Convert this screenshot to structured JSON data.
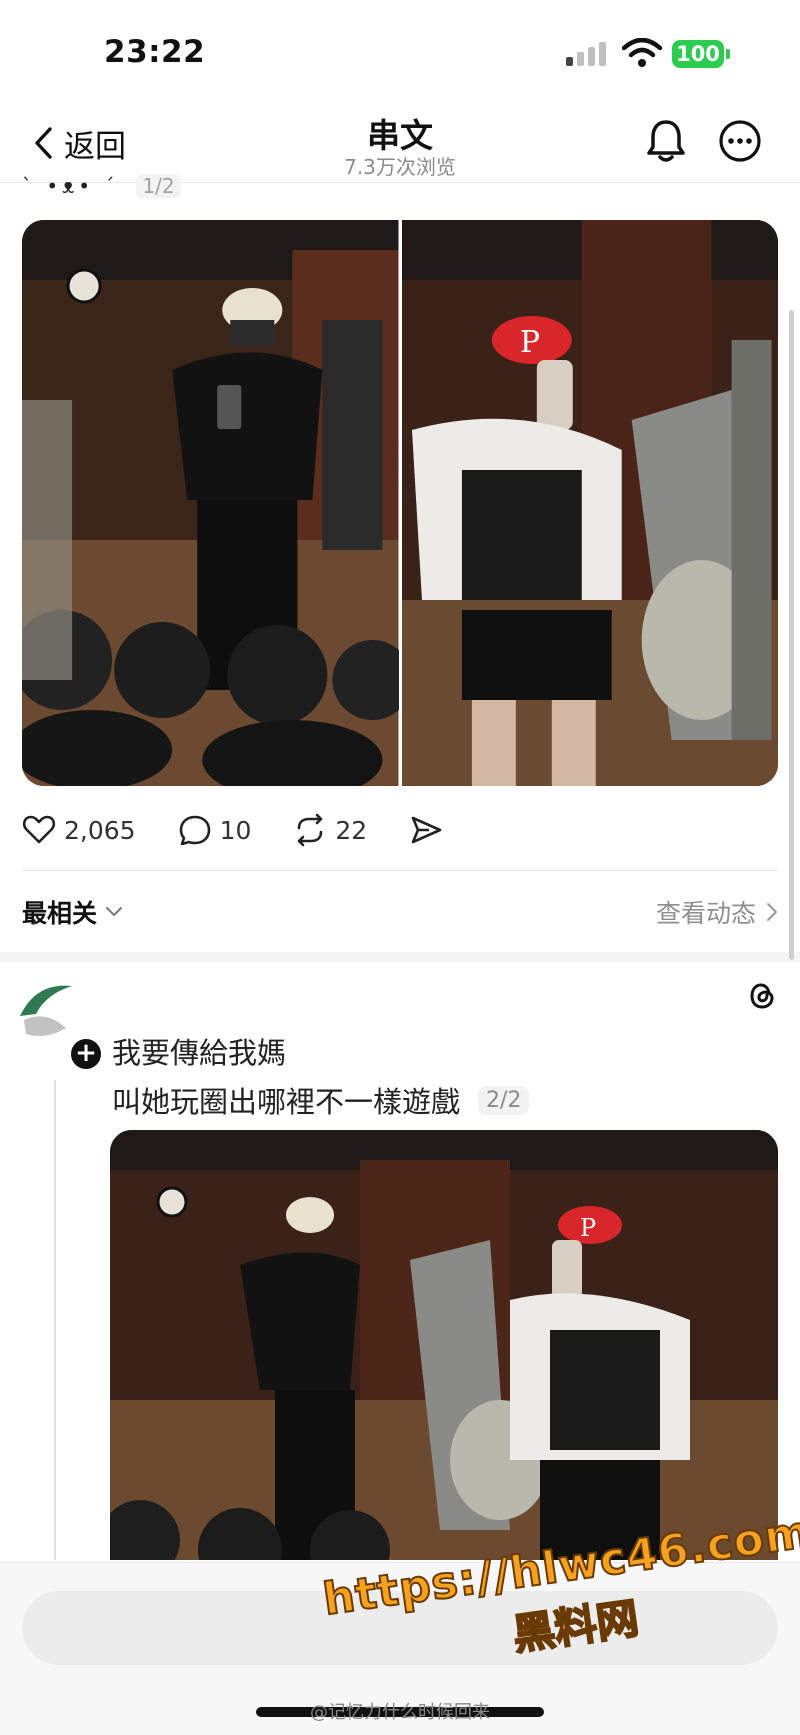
{
  "status": {
    "time": "23:22",
    "battery": "100"
  },
  "nav": {
    "back_label": "返回",
    "title": "串文",
    "subtitle": "7.3万次浏览"
  },
  "post1": {
    "text_fragment": "ˋ •ᴥ• ˊ",
    "page_indicator": "1/2"
  },
  "actions": {
    "likes": "2,065",
    "comments": "10",
    "reposts": "22"
  },
  "sort": {
    "label": "最相关",
    "feed_link": "查看动态"
  },
  "reply": {
    "line1": "我要傳給我媽",
    "line2": "叫她玩圈出哪裡不一樣遊戲",
    "page_indicator": "2/2"
  },
  "bottom": {
    "handle": "@记忆力什么时候回来"
  },
  "watermark": {
    "url": "https://hlwc46.com",
    "name": "黑料网"
  },
  "colors": {
    "accent_green": "#2ecb51",
    "watermark_orange": "#f6a21e",
    "cap_red": "#d8262a"
  }
}
